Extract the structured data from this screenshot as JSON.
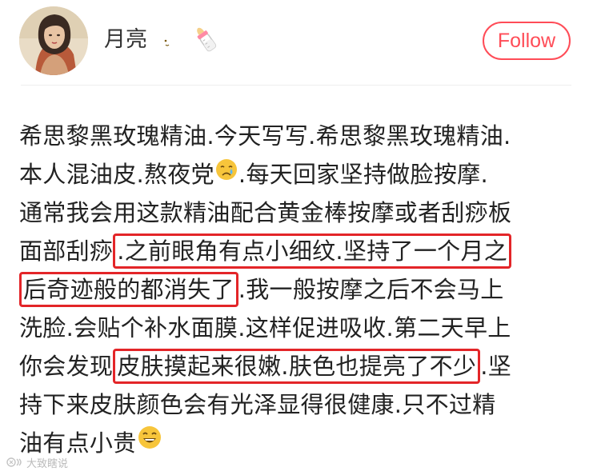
{
  "header": {
    "username": "月亮",
    "follow_label": "Follow",
    "name_icons": [
      "moon-icon",
      "baby-bottle-icon"
    ]
  },
  "post": {
    "lines": [
      {
        "t1": "希思黎黑玫瑰精油.今天写写.希思黎黑玫瑰精油."
      },
      {
        "t1": "本人混油皮.熬夜党",
        "emoji": "crying-face-emoji",
        "t2": ".每天回家坚持做脸按摩."
      },
      {
        "t1": "通常我会用这款精油配合黄金棒按摩或者刮痧板"
      },
      {
        "t1": "面部刮痧",
        "h": ".之前眼角有点小细纹.坚持了一个月之"
      },
      {
        "h": "后奇迹般的都消失了",
        "t2": ".我一般按摩之后不会马上"
      },
      {
        "t1": "洗脸.会贴个补水面膜.这样促进吸收.第二天早上"
      },
      {
        "t1": "你会发现",
        "h": "皮肤摸起来很嫩.肤色也提亮了不少",
        "t2": ".坚"
      },
      {
        "t1": "持下来皮肤颜色会有光泽显得很健康.只不过精"
      },
      {
        "t1": "油有点小贵",
        "emoji": "grinning-face-emoji"
      }
    ]
  },
  "colors": {
    "follow": "#ff4c57",
    "highlight_box": "#e32528",
    "text": "#222222"
  },
  "watermark": {
    "text": "大致瞎说"
  }
}
